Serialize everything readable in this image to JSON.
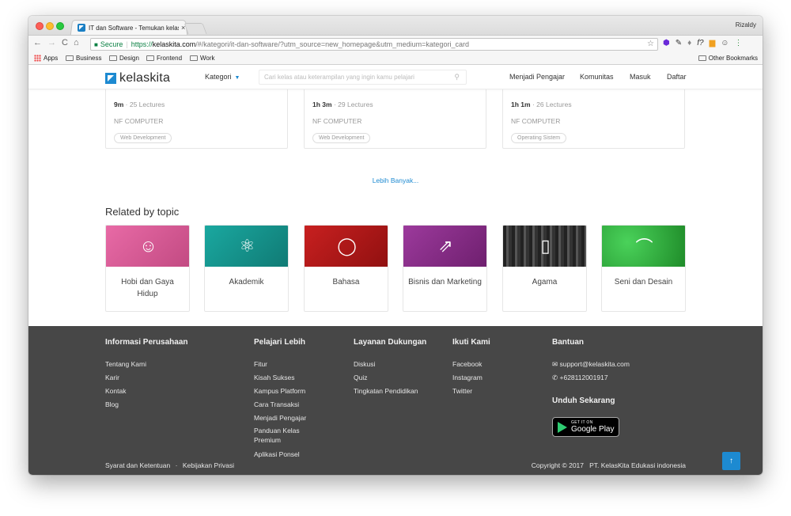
{
  "browser": {
    "tab_title": "IT dan Software - Temukan kelas",
    "tab_close": "×",
    "profile_name": "Rizaldy",
    "secure_label": "Secure",
    "url_https": "https://",
    "url_host": "kelaskita.com",
    "url_rest": "/#/kategori/it-dan-software/?utm_source=new_homepage&utm_medium=kategori_card",
    "bookmarks": [
      "Apps",
      "Business",
      "Design",
      "Frontend",
      "Work"
    ],
    "other_bookmarks": "Other Bookmarks"
  },
  "header": {
    "logo_text": "kelaskita",
    "kategori_label": "Kategori",
    "search_placeholder": "Cari kelas atau keterampilan yang ingin kamu pelajari",
    "links": [
      "Menjadi Pengajar",
      "Komunitas",
      "Masuk",
      "Daftar"
    ]
  },
  "courses": [
    {
      "duration": "9m",
      "lectures": "· 25 Lectures",
      "author": "NF COMPUTER",
      "tag": "Web Development"
    },
    {
      "duration": "1h 3m",
      "lectures": "· 29 Lectures",
      "author": "NF COMPUTER",
      "tag": "Web Development"
    },
    {
      "duration": "1h 1m",
      "lectures": "· 26 Lectures",
      "author": "NF COMPUTER",
      "tag": "Operating Sistem"
    }
  ],
  "more_link": "Lebih Banyak...",
  "related": {
    "title": "Related by topic",
    "topics": [
      {
        "name": "Hobi dan Gaya Hidup",
        "icon": "person-heart-icon",
        "color": "#e0609a"
      },
      {
        "name": "Akademik",
        "icon": "atom-icon",
        "color": "#159a93"
      },
      {
        "name": "Bahasa",
        "icon": "chat-bubble-icon",
        "color": "#b51a1a"
      },
      {
        "name": "Bisnis dan Marketing",
        "icon": "growth-chart-icon",
        "color": "#8a2a8a"
      },
      {
        "name": "Agama",
        "icon": "book-icon",
        "color": "#3a3a3a"
      },
      {
        "name": "Seni dan Desain",
        "icon": "vector-pen-icon",
        "color": "#2a9a34"
      }
    ]
  },
  "footer": {
    "col1": {
      "title": "Informasi Perusahaan",
      "links": [
        "Tentang Kami",
        "Karir",
        "Kontak",
        "Blog"
      ]
    },
    "col2": {
      "title": "Pelajari Lebih",
      "links": [
        "Fitur",
        "Kisah Sukses",
        "Kampus Platform",
        "Cara Transaksi",
        "Menjadi Pengajar",
        "Panduan Kelas Premium",
        "Aplikasi Ponsel"
      ]
    },
    "col3": {
      "title": "Layanan Dukungan",
      "links": [
        "Diskusi",
        "Quiz",
        "Tingkatan Pendidikan"
      ]
    },
    "col4": {
      "title": "Ikuti Kami",
      "links": [
        "Facebook",
        "Instagram",
        "Twitter"
      ]
    },
    "col5": {
      "title": "Bantuan",
      "email": "support@kelaskita.com",
      "phone": "+628112001917",
      "download_title": "Unduh Sekarang"
    },
    "gplay_small": "GET IT ON",
    "gplay_big": "Google Play",
    "terms": "Syarat dan Ketentuan",
    "separator": "·",
    "privacy": "Kebijakan Privasi",
    "copyright": "Copyright © 2017   PT. KelasKita Edukasi indonesia"
  }
}
